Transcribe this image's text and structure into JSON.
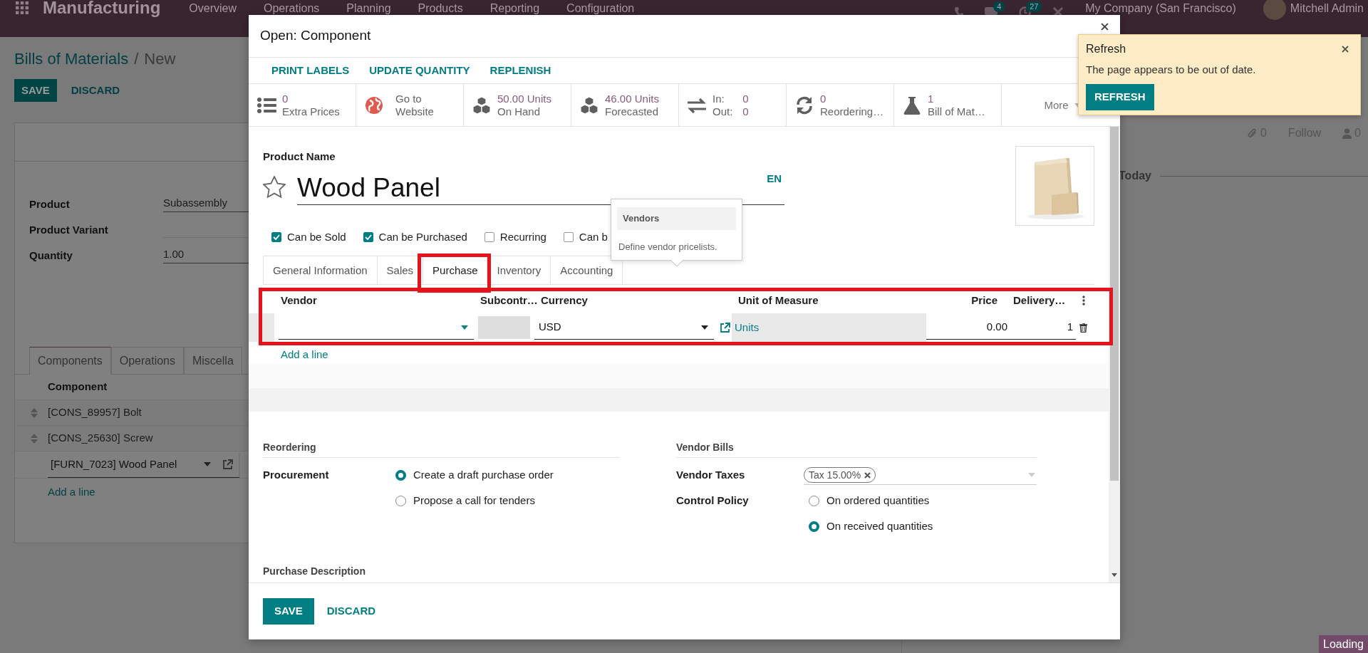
{
  "top_bar": {
    "app_name": "Manufacturing",
    "menu": [
      "Overview",
      "Operations",
      "Planning",
      "Products",
      "Reporting",
      "Configuration"
    ],
    "messages_count": "4",
    "activities_count": "27",
    "company": "My Company (San Francisco)",
    "user": "Mitchell Admin"
  },
  "page": {
    "breadcrumbs": [
      "Bills of Materials",
      "New"
    ],
    "breadcrumb_separator": "/",
    "buttons": [
      {
        "label": "SAVE",
        "kind": "primary"
      },
      {
        "label": "DISCARD",
        "kind": "link"
      }
    ],
    "fields": [
      {
        "label": "Product",
        "value": "Subassembly"
      },
      {
        "label": "Product Variant"
      },
      {
        "label": "Quantity",
        "value": "1.00"
      }
    ],
    "tabs": [
      {
        "label": "Components",
        "selected": true
      },
      {
        "label": "Operations",
        "selected": false
      },
      {
        "label": "Miscella",
        "selected": false
      }
    ],
    "table": {
      "column": "Component",
      "rows": [
        {
          "kind": "line",
          "text": "[CONS_89957] Bolt"
        },
        {
          "kind": "line",
          "text": "[CONS_25630] Screw"
        },
        {
          "kind": "editing",
          "text": "[FURN_7023] Wood Panel"
        }
      ],
      "add_line": "Add a line"
    }
  },
  "chatter": {
    "attachments": "0",
    "follow": "Follow",
    "followers": "0",
    "separator": "Today"
  },
  "dialog": {
    "title": "Open: Component",
    "actions": [
      "PRINT LABELS",
      "UPDATE QUANTITY",
      "REPLENISH"
    ],
    "stats": [
      {
        "kind": "count",
        "value": "0",
        "label": "Extra Prices"
      },
      {
        "kind": "link",
        "lines": [
          "Go to",
          "Website"
        ]
      },
      {
        "kind": "count",
        "value": "50.00 Units",
        "label": "On Hand"
      },
      {
        "kind": "count",
        "value": "46.00 Units",
        "label": "Forecasted"
      },
      {
        "kind": "inout",
        "in_label": "In:",
        "in_value": "0",
        "out_label": "Out:",
        "out_value": "0"
      },
      {
        "kind": "count",
        "value": "0",
        "label": "Reordering…"
      },
      {
        "kind": "count",
        "value": "1",
        "label": "Bill of Mat…"
      },
      {
        "kind": "more",
        "label": "More"
      }
    ],
    "product_name_label": "Product Name",
    "product_name": "Wood Panel",
    "starred": false,
    "language": "EN",
    "checkboxes": [
      {
        "label": "Can be Sold",
        "checked": true
      },
      {
        "label": "Can be Purchased",
        "checked": true
      },
      {
        "label": "Recurring",
        "checked": false
      },
      {
        "label": "Can b",
        "checked": false
      }
    ],
    "tabs": [
      {
        "label": "General Information",
        "selected": false,
        "highlighted": false
      },
      {
        "label": "Sales",
        "selected": false,
        "highlighted": false
      },
      {
        "label": "Purchase",
        "selected": true,
        "highlighted": true
      },
      {
        "label": "Inventory",
        "selected": false,
        "highlighted": false
      },
      {
        "label": "Accounting",
        "selected": false,
        "highlighted": false
      }
    ],
    "vendor_table": {
      "highlighted": true,
      "columns": [
        "Vendor",
        "Subcontr…",
        "Currency",
        "Unit of Measure",
        "Price",
        "Delivery…"
      ],
      "row": {
        "currency": "USD",
        "unit": "Units",
        "price": "0.00",
        "delivery": "1"
      },
      "add_line": "Add a line"
    },
    "reordering": {
      "heading": "Reordering",
      "label": "Procurement",
      "options": [
        {
          "label": "Create a draft purchase order",
          "selected": true
        },
        {
          "label": "Propose a call for tenders",
          "selected": false
        }
      ]
    },
    "vendor_bills": {
      "heading": "Vendor Bills",
      "taxes_label": "Vendor Taxes",
      "taxes": [
        "Tax 15.00%"
      ],
      "policy_label": "Control Policy",
      "policy_options": [
        {
          "label": "On ordered quantities",
          "selected": false
        },
        {
          "label": "On received quantities",
          "selected": true
        }
      ]
    },
    "next_section": "Purchase Description",
    "footer_buttons": [
      {
        "label": "SAVE",
        "kind": "primary"
      },
      {
        "label": "DISCARD",
        "kind": "link"
      }
    ]
  },
  "tooltip": {
    "title": "Vendors",
    "text": "Define vendor pricelists."
  },
  "notification": {
    "title": "Refresh",
    "message": "The page appears to be out of date.",
    "button": "REFRESH"
  },
  "status": "Loading"
}
